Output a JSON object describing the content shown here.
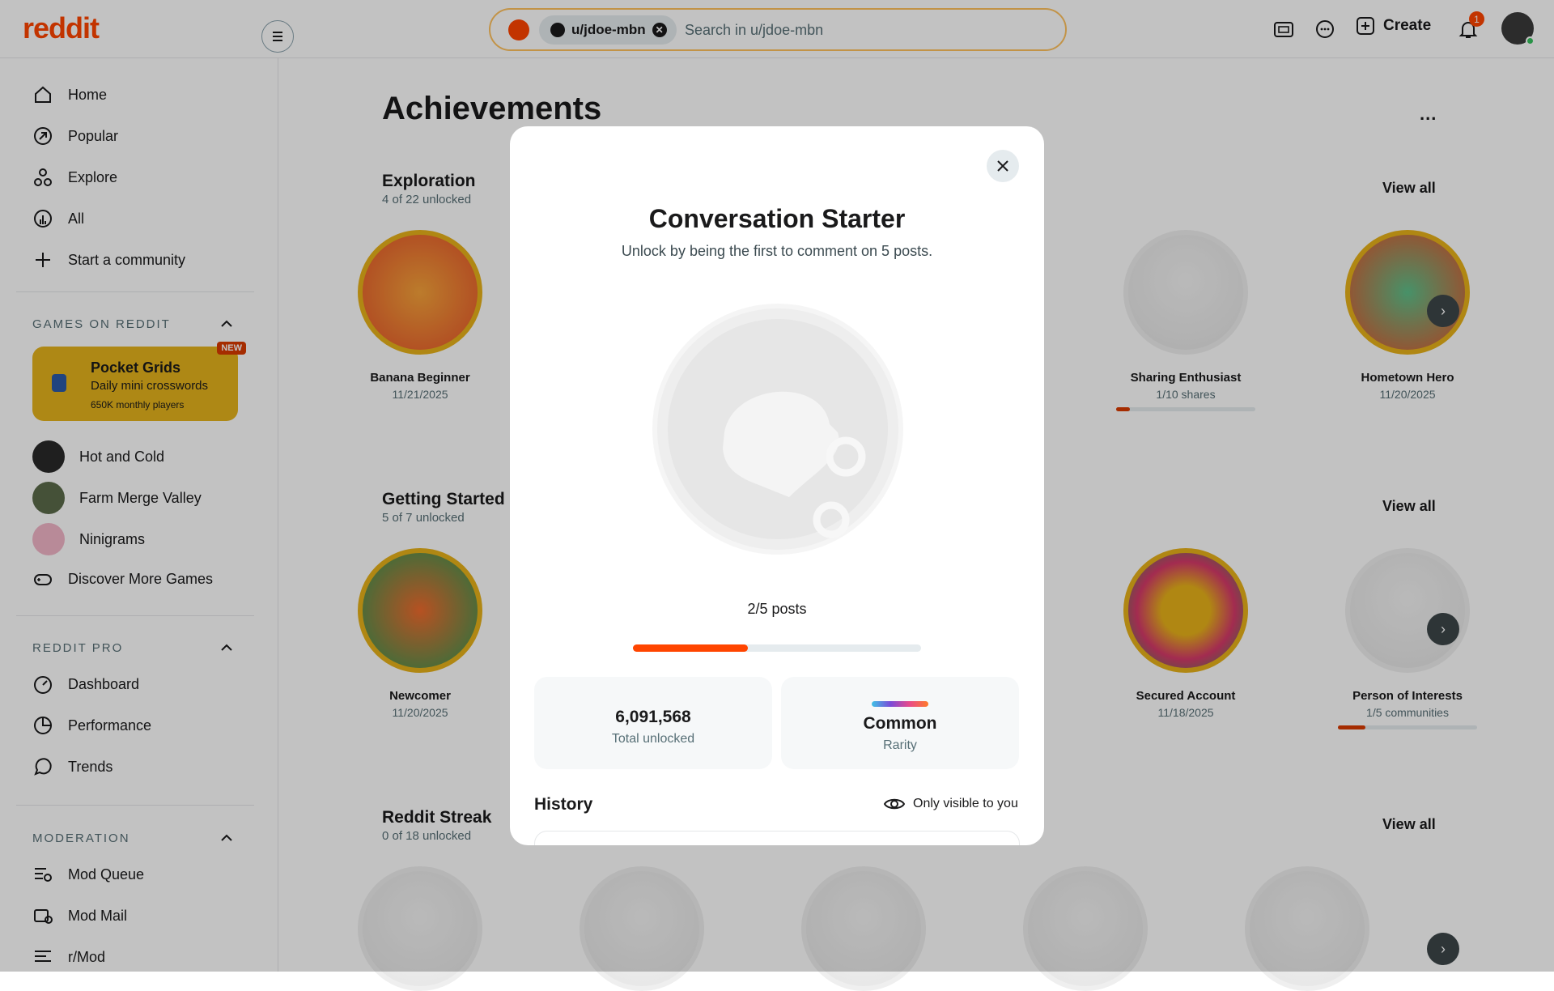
{
  "header": {
    "logo": "reddit",
    "search_chip": "u/jdoe-mbn",
    "search_placeholder": "Search in u/jdoe-mbn",
    "create_label": "Create",
    "notification_count": "1"
  },
  "sidebar": {
    "nav": [
      "Home",
      "Popular",
      "Explore",
      "All",
      "Start a community"
    ],
    "games_heading": "GAMES ON REDDIT",
    "promo": {
      "title": "Pocket Grids",
      "subtitle": "Daily mini crosswords",
      "players": "650K monthly players",
      "badge": "NEW"
    },
    "games": [
      "Hot and Cold",
      "Farm Merge Valley",
      "Ninigrams",
      "Discover More Games"
    ],
    "pro_heading": "REDDIT PRO",
    "pro": [
      "Dashboard",
      "Performance",
      "Trends"
    ],
    "mod_heading": "MODERATION",
    "mod": [
      "Mod Queue",
      "Mod Mail",
      "r/Mod"
    ]
  },
  "main": {
    "title": "Achievements",
    "more": "...",
    "view_all": "View all",
    "sections": [
      {
        "title": "Exploration",
        "subtitle": "4 of 22 unlocked",
        "left": {
          "name": "Banana Beginner",
          "detail": "11/21/2025"
        },
        "right": [
          {
            "name": "Sharing Enthusiast",
            "detail": "1/10 shares",
            "progress": 0.1
          },
          {
            "name": "Hometown Hero",
            "detail": "11/20/2025"
          }
        ]
      },
      {
        "title": "Getting Started",
        "subtitle": "5 of 7 unlocked",
        "left": {
          "name": "Newcomer",
          "detail": "11/20/2025"
        },
        "right": [
          {
            "name": "Secured Account",
            "detail": "11/18/2025"
          },
          {
            "name": "Person of Interests",
            "detail": "1/5 communities",
            "progress": 0.2
          }
        ]
      },
      {
        "title": "Reddit Streak",
        "subtitle": "0 of 18 unlocked"
      }
    ]
  },
  "modal": {
    "title": "Conversation Starter",
    "description": "Unlock by being the first to comment on 5 posts.",
    "progress_text": "2/5 posts",
    "progress": 0.4,
    "total_unlocked": "6,091,568",
    "total_unlocked_label": "Total unlocked",
    "rarity": "Common",
    "rarity_label": "Rarity",
    "history_title": "History",
    "visibility": "Only visible to you"
  },
  "colors": {
    "brand": "#ff4500",
    "overlay": "rgba(0,0,0,0.24)"
  }
}
